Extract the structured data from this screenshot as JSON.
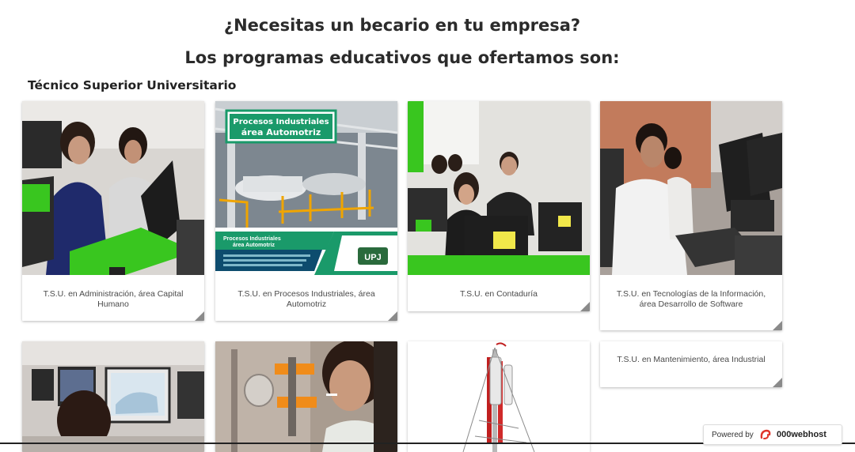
{
  "header": {
    "question": "¿Necesitas un becario en tu empresa?",
    "subtitle": "Los programas educativos que ofertamos son:"
  },
  "section": {
    "title": "Técnico Superior Universitario"
  },
  "programs": [
    {
      "caption": "T.S.U. en Administración, área Capital Humano"
    },
    {
      "caption": "T.S.U. en Procesos Industriales, área Automotriz",
      "poster_title_1": "Procesos Industriales",
      "poster_title_2": "área Automotriz",
      "poster_sub_1": "Procesos Industriales",
      "poster_sub_2": "área Automotriz",
      "logo_text": "UPJ"
    },
    {
      "caption": "T.S.U. en Contaduría"
    },
    {
      "caption": "T.S.U. en Tecnologías de la Información, área Desarrollo de Software"
    },
    {
      "caption": ""
    },
    {
      "caption": ""
    },
    {
      "caption": ""
    },
    {
      "caption": "T.S.U. en Mantenimiento, área Industrial"
    }
  ],
  "footer_badge": {
    "powered_by": "Powered by",
    "brand": "000webhost"
  },
  "colors": {
    "accent_green": "#39c61f",
    "poster_green": "#1a9a6a",
    "fold": "#8a8a8a"
  }
}
